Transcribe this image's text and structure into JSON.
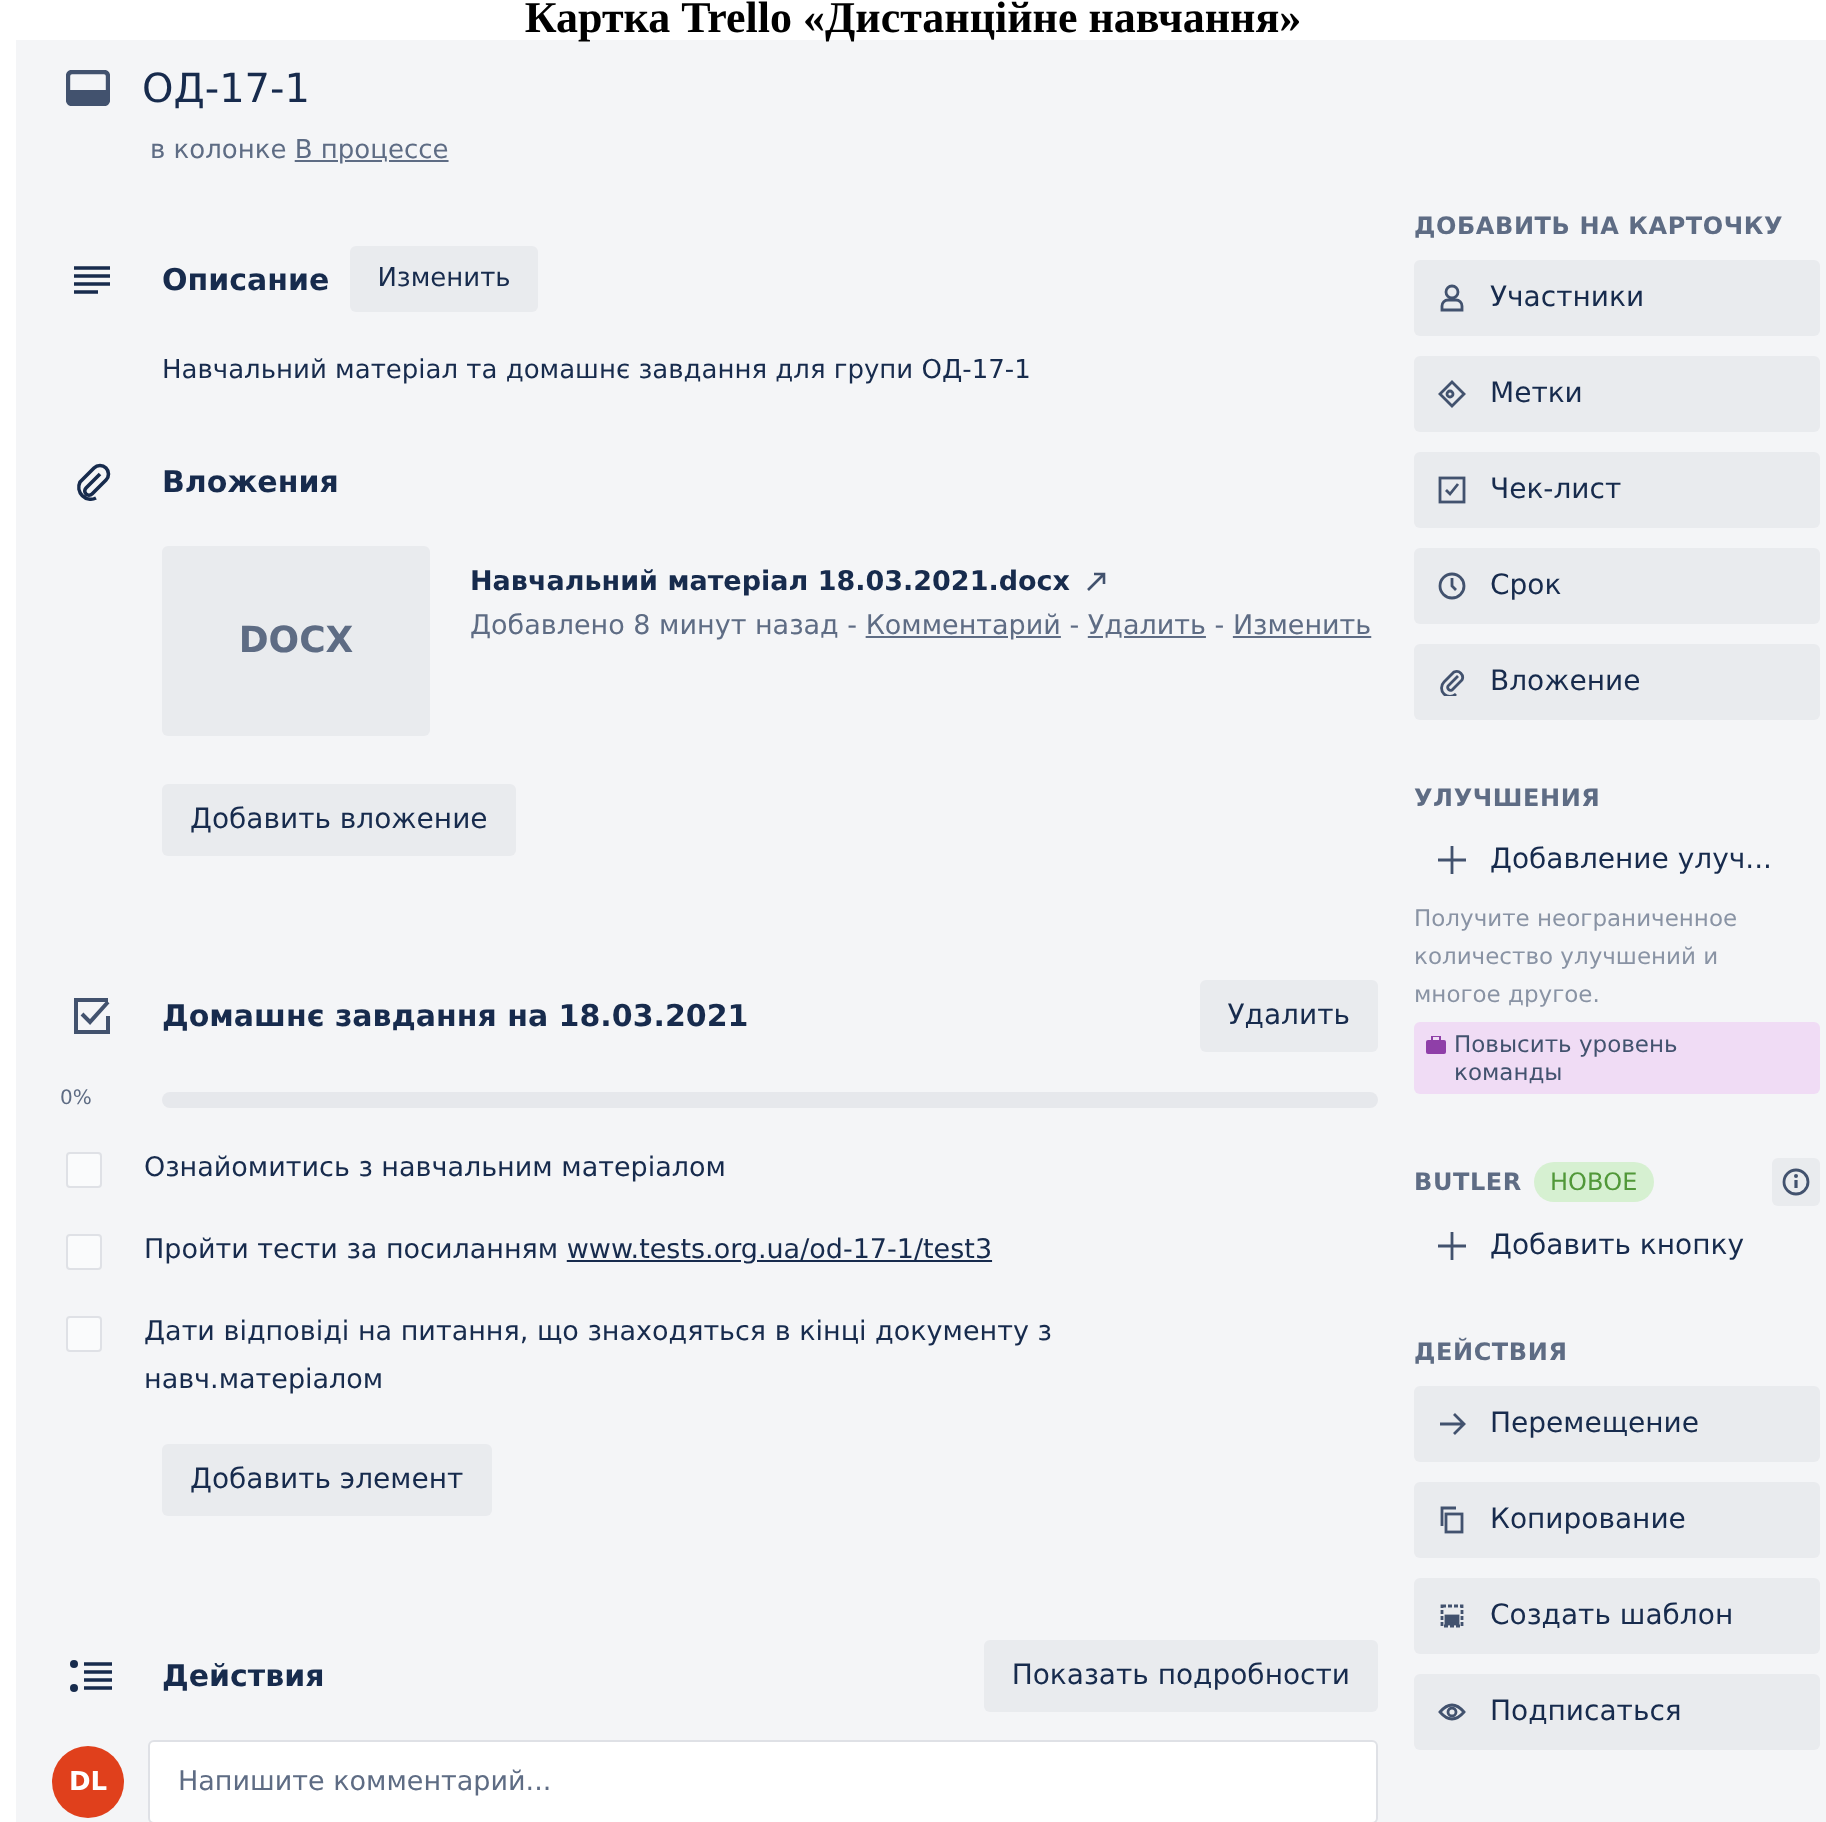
{
  "caption": "Картка Trello «Дистанційне навчання»",
  "card": {
    "title": "ОД-17-1",
    "list_prefix": "в колонке",
    "list_name": "В процессе"
  },
  "description": {
    "heading": "Описание",
    "edit_button": "Изменить",
    "text": "Навчальний матеріал та домашнє завдання для групи ОД-17-1"
  },
  "attachments": {
    "heading": "Вложения",
    "items": [
      {
        "thumb": "DOCX",
        "name": "Навчальний матеріал 18.03.2021.docx",
        "meta": [
          {
            "kind": "text",
            "text": "Добавлено 8 минут назад -"
          },
          {
            "kind": "link",
            "text": "Комментарий"
          },
          {
            "kind": "text",
            "text": "-"
          },
          {
            "kind": "link",
            "text": "Удалить"
          },
          {
            "kind": "text",
            "text": "-"
          },
          {
            "kind": "link",
            "text": "Изменить"
          }
        ]
      }
    ],
    "add_button": "Добавить вложение"
  },
  "checklist": {
    "heading": "Домашнє завдання на 18.03.2021",
    "delete_button": "Удалить",
    "percent": "0%",
    "level": 0,
    "items": [
      {
        "text": "Ознайомитись з навчальним матеріалом",
        "checked": false
      },
      {
        "text": "Пройти тести за посиланням ",
        "link": "www.tests.org.ua/od-17-1/test3",
        "checked": false
      },
      {
        "text": "Дати відповіді на питання, що знаходяться в кінці документу з навч.матеріалом",
        "checked": false
      }
    ],
    "add_button": "Добавить элемент"
  },
  "activity": {
    "heading": "Действия",
    "details_button": "Показать подробности",
    "avatar": "DL",
    "comment_placeholder": "Напишите комментарий..."
  },
  "sidebar": [
    {
      "kind": "buttons",
      "title": "ДОБАВИТЬ НА КАРТОЧКУ",
      "items": [
        {
          "label": "Участники"
        },
        {
          "label": "Метки"
        },
        {
          "label": "Чек-лист"
        },
        {
          "label": "Срок"
        },
        {
          "label": "Вложение"
        }
      ]
    },
    {
      "kind": "powerups",
      "title": "УЛУЧШЕНИЯ",
      "add": "Добавление улуч...",
      "note": "Получите неограниченное количество улучшений и многое другое.",
      "upgrade": "Повысить уровень команды"
    },
    {
      "kind": "butler",
      "title": "BUTLER",
      "badge": "НОВОЕ",
      "add": "Добавить кнопку"
    },
    {
      "kind": "buttons",
      "title": "ДЕЙСТВИЯ",
      "items": [
        {
          "label": "Перемещение"
        },
        {
          "label": "Копирование"
        },
        {
          "label": "Создать шаблон"
        },
        {
          "label": "Подписаться"
        }
      ]
    }
  ]
}
